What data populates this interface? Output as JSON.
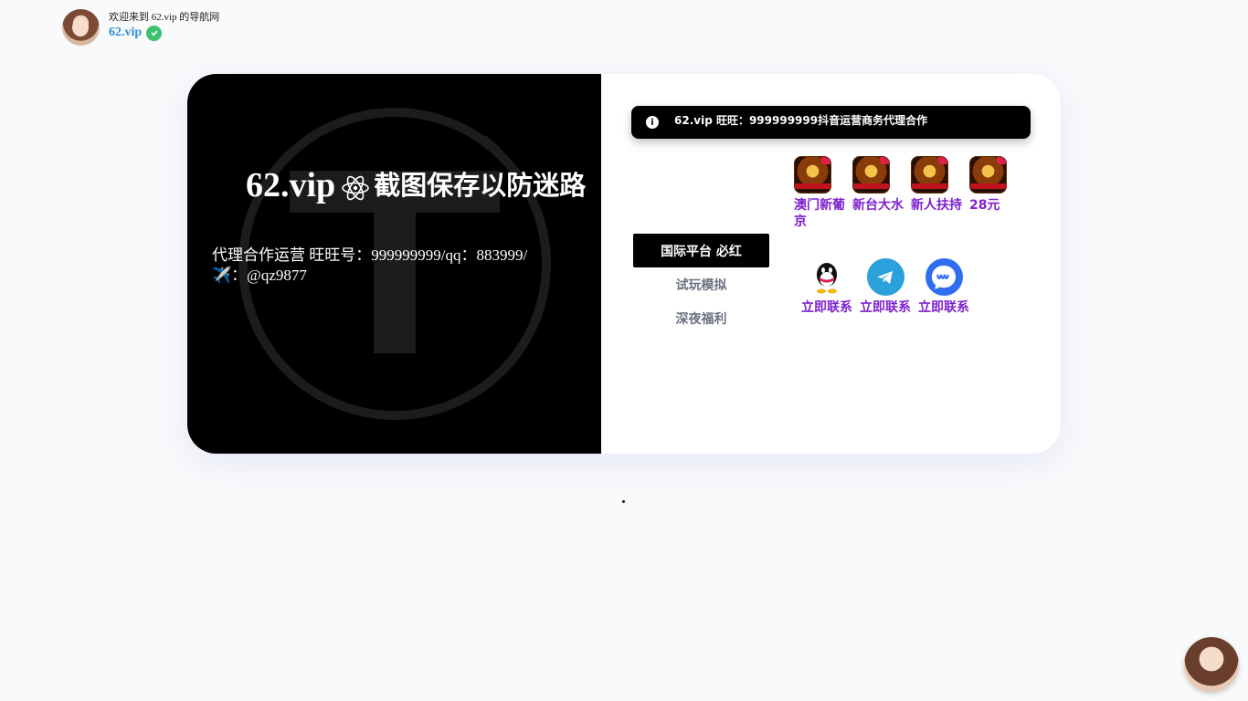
{
  "header": {
    "welcome": "欢迎来到 62.vip 的导航网",
    "brand": "62.vip"
  },
  "hero": {
    "site": "62.vip",
    "title": "截图保存以防迷路",
    "description": "代理合作运营 旺旺号：999999999/qq：883999/✈️：@qz9877"
  },
  "notice": {
    "text": "62.vip 旺旺：999999999抖音运营商务代理合作"
  },
  "tabs": [
    {
      "label": "国际平台 必红",
      "active": true
    },
    {
      "label": "试玩模拟",
      "active": false
    },
    {
      "label": "深夜福利",
      "active": false
    }
  ],
  "apps": [
    {
      "label": "澳门新葡京"
    },
    {
      "label": "新台大水"
    },
    {
      "label": "新人扶持"
    },
    {
      "label": "28元"
    }
  ],
  "contacts": [
    {
      "icon": "qq-icon",
      "label": "立即联系"
    },
    {
      "icon": "telegram-icon",
      "label": "立即联系"
    },
    {
      "icon": "messenger-icon",
      "label": "立即联系"
    }
  ],
  "colors": {
    "accent_purple": "#7e22ce",
    "brand_blue": "#2b8fd1",
    "verified_green": "#3ec06d",
    "dark_panel": "#000000"
  }
}
